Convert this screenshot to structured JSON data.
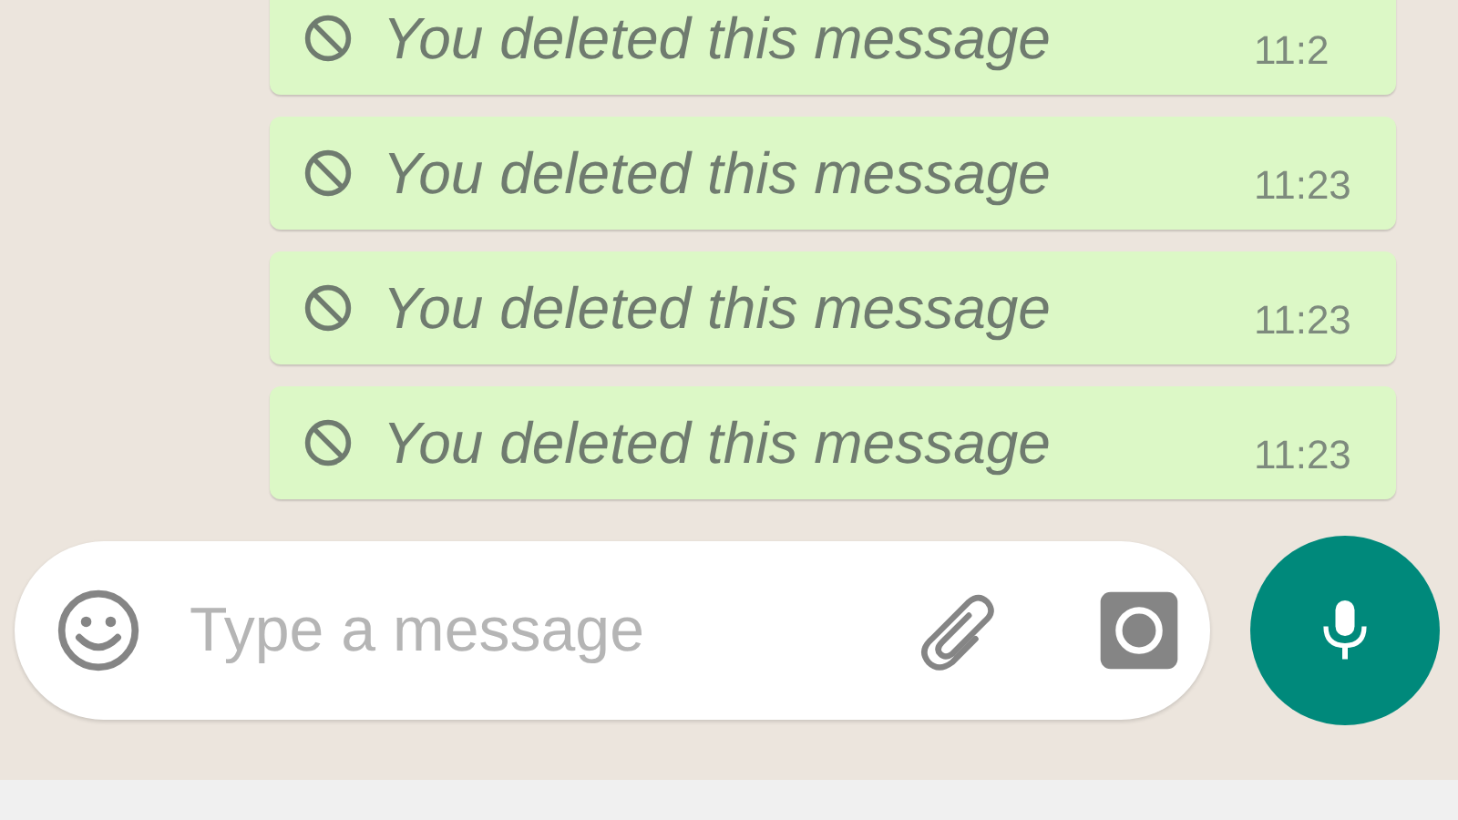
{
  "messages": [
    {
      "text": "You deleted this message",
      "time": "11:2"
    },
    {
      "text": "You deleted this message",
      "time": "11:23"
    },
    {
      "text": "You deleted this message",
      "time": "11:23"
    },
    {
      "text": "You deleted this message",
      "time": "11:23"
    }
  ],
  "composer": {
    "placeholder": "Type a message"
  }
}
